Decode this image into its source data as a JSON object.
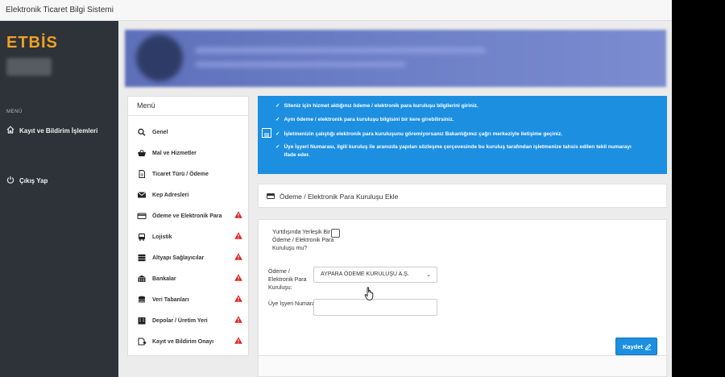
{
  "window": {
    "title": "Elektronik Ticaret Bilgi Sistemi"
  },
  "sidebar": {
    "logo": "ETBİS",
    "menu_caption": "MENÜ",
    "links": [
      {
        "label": "Kayıt ve Bildirim İşlemleri",
        "icon": "home-icon"
      },
      {
        "label": "Çıkış Yap",
        "icon": "power-icon"
      }
    ]
  },
  "menu": {
    "title": "Menü",
    "items": [
      {
        "label": "Genel",
        "icon": "search-icon",
        "warning": false
      },
      {
        "label": "Mal ve Hizmetler",
        "icon": "basket-icon",
        "warning": false
      },
      {
        "label": "Ticaret Türü / Ödeme",
        "icon": "document-icon",
        "warning": false
      },
      {
        "label": "Kep Adresleri",
        "icon": "envelope-icon",
        "warning": false
      },
      {
        "label": "Ödeme ve Elektronik Para",
        "icon": "credit-card-icon",
        "warning": true
      },
      {
        "label": "Lojistik",
        "icon": "bus-icon",
        "warning": true
      },
      {
        "label": "Altyapı Sağlayıcılar",
        "icon": "server-icon",
        "warning": true
      },
      {
        "label": "Bankalar",
        "icon": "bank-icon",
        "warning": true
      },
      {
        "label": "Veri Tabanları",
        "icon": "database-icon",
        "warning": true
      },
      {
        "label": "Depolar / Üretim Yeri",
        "icon": "building-icon",
        "warning": true
      },
      {
        "label": "Kayıt ve Bildirim Onayı",
        "icon": "approve-icon",
        "warning": true
      }
    ]
  },
  "info": {
    "lines": [
      "Siteniz için hizmet aldığınız ödeme / elektronik para kuruluşu bilgilerini giriniz.",
      "Aynı ödeme / elektronik para kuruluşu bilgisini bir kere girebilirsiniz.",
      "İşletmenizin çalıştığı elektronik para kuruluşunu göremiyorsanız Bakanlığımız çağrı merkeziyle iletişime geçiniz.",
      "Üye İşyeri Numarası, ilgili kuruluş ile aranızda yapılan sözleşme çerçevesinde bu kuruluş tarafından işletmenize tahsis edilen tekil numarayı ifade eder."
    ]
  },
  "form": {
    "header": "Ödeme / Elektronik Para Kuruluşu Ekle",
    "abroad_label": "Yurtdışında Yerleşik Bir Ödeme / Elektronik Para Kuruluşu mu?",
    "abroad_checked": false,
    "institution_label": "Ödeme / Elektronik Para Kuruluşu:",
    "institution_value": "AYPARA ÖDEME KURULUŞU A.Ş.",
    "member_label": "Üye İşyeri Numarası:",
    "member_value": "",
    "save_label": "Kaydet"
  },
  "colors": {
    "accent": "#1c8fe0",
    "sidebar": "#2d3338",
    "logo": "#f0a024",
    "warning": "#e02424"
  }
}
